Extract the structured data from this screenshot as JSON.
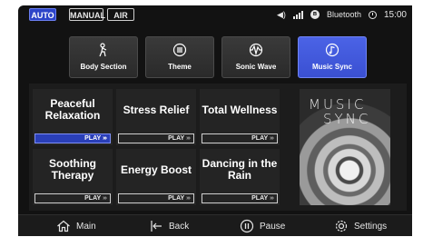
{
  "status": {
    "modes": [
      {
        "label": "AUTO",
        "active": true
      },
      {
        "label": "MANUAL",
        "active": false
      },
      {
        "label": "AIR",
        "active": false
      }
    ],
    "bluetooth_label": "Bluetooth",
    "time": "15:00"
  },
  "categories": [
    {
      "label": "Body Section",
      "icon": "body-icon",
      "active": false
    },
    {
      "label": "Theme",
      "icon": "theme-icon",
      "active": false
    },
    {
      "label": "Sonic Wave",
      "icon": "sonic-wave-icon",
      "active": false
    },
    {
      "label": "Music Sync",
      "icon": "music-icon",
      "active": true
    }
  ],
  "programs": [
    {
      "title": "Peaceful Relaxation",
      "play": "PLAY",
      "selected": true
    },
    {
      "title": "Stress Relief",
      "play": "PLAY",
      "selected": false
    },
    {
      "title": "Total Wellness",
      "play": "PLAY",
      "selected": false
    },
    {
      "title": "Soothing Therapy",
      "play": "PLAY",
      "selected": false
    },
    {
      "title": "Energy Boost",
      "play": "PLAY",
      "selected": false
    },
    {
      "title": "Dancing in the Rain",
      "play": "PLAY",
      "selected": false
    }
  ],
  "artwork": {
    "line1": "MUSIC",
    "line2": "SYNC"
  },
  "nav": [
    {
      "label": "Main",
      "icon": "home-icon"
    },
    {
      "label": "Back",
      "icon": "back-icon"
    },
    {
      "label": "Pause",
      "icon": "pause-icon"
    },
    {
      "label": "Settings",
      "icon": "gear-icon"
    }
  ],
  "colors": {
    "accent": "#3a50d2",
    "background": "#121212"
  }
}
